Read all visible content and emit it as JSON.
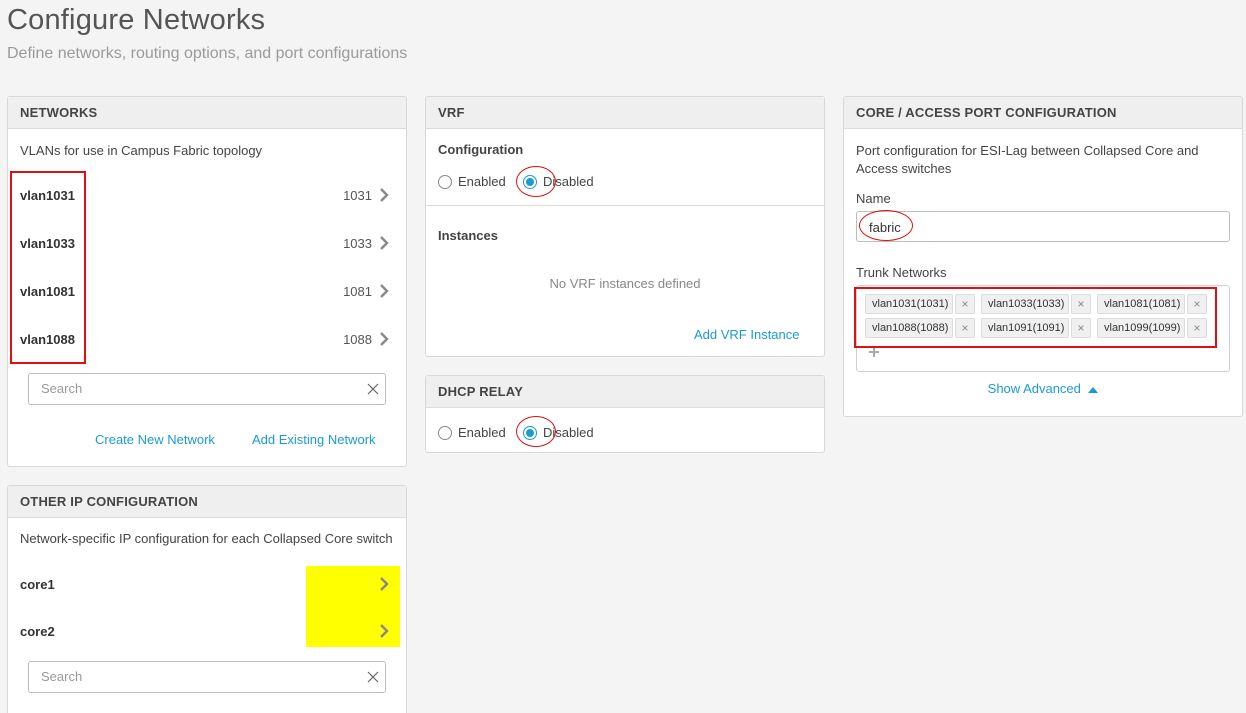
{
  "page": {
    "title": "Configure Networks",
    "subtitle": "Define networks, routing options, and port configurations"
  },
  "networks": {
    "header": "NETWORKS",
    "description": "VLANs for use in Campus Fabric topology",
    "items": [
      {
        "name": "vlan1031",
        "id": "1031"
      },
      {
        "name": "vlan1033",
        "id": "1033"
      },
      {
        "name": "vlan1081",
        "id": "1081"
      },
      {
        "name": "vlan1088",
        "id": "1088"
      }
    ],
    "search_placeholder": "Search",
    "create_label": "Create New Network",
    "add_existing_label": "Add Existing Network"
  },
  "other_ip": {
    "header": "OTHER IP CONFIGURATION",
    "description": "Network-specific IP configuration for each Collapsed Core switch",
    "items": [
      "core1",
      "core2"
    ],
    "search_placeholder": "Search",
    "highlight_color": "#ffff00"
  },
  "vrf": {
    "header": "VRF",
    "config_label": "Configuration",
    "enabled_label": "Enabled",
    "disabled_label": "Disabled",
    "selected": "Disabled",
    "instances_label": "Instances",
    "empty_text": "No VRF instances defined",
    "add_label": "Add VRF Instance"
  },
  "dhcp": {
    "header": "DHCP RELAY",
    "enabled_label": "Enabled",
    "disabled_label": "Disabled",
    "selected": "Disabled"
  },
  "core_access": {
    "header": "CORE / ACCESS PORT CONFIGURATION",
    "description": "Port configuration for ESI-Lag between Collapsed Core and Access switches",
    "name_label": "Name",
    "name_value": "fabric",
    "trunk_label": "Trunk Networks",
    "trunk_networks": [
      "vlan1031(1031)",
      "vlan1033(1033)",
      "vlan1081(1081)",
      "vlan1088(1088)",
      "vlan1091(1091)",
      "vlan1099(1099)"
    ],
    "show_advanced_label": "Show Advanced"
  },
  "colors": {
    "accent": "#1a9bd7",
    "annotation_red": "#dd1111",
    "highlight_yellow": "#ffff00"
  }
}
